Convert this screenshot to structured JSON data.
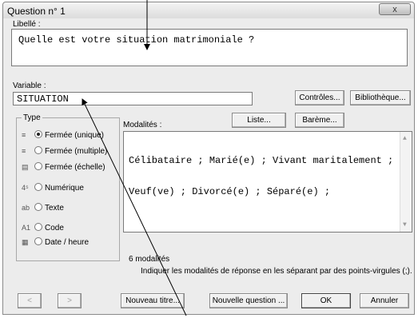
{
  "window": {
    "title": "Question n° 1",
    "close_label": "x"
  },
  "question": {
    "libelle_label": "Libellé :",
    "libelle_value": "Quelle est votre situation matrimoniale ?"
  },
  "variable": {
    "label": "Variable :",
    "value": "SITUATION"
  },
  "buttons": {
    "controles": "Contrôles...",
    "bibliotheque": "Bibliothèque...",
    "liste": "Liste...",
    "bareme": "Barème...",
    "prev": "<",
    "next": ">",
    "nouveau_titre": "Nouveau titre...",
    "nouvelle_question": "Nouvelle question ...",
    "ok": "OK",
    "annuler": "Annuler"
  },
  "type_group": {
    "legend": "Type",
    "options": [
      {
        "icon": "≡",
        "label": "Fermée (unique)",
        "checked": true
      },
      {
        "icon": "≡",
        "label": "Fermée (multiple)",
        "checked": false
      },
      {
        "icon": "▤",
        "label": "Fermée (échelle)",
        "checked": false
      },
      {
        "icon": "4⁵",
        "label": "Numérique",
        "checked": false
      },
      {
        "icon": "ab",
        "label": "Texte",
        "checked": false
      },
      {
        "icon": "A1",
        "label": "Code",
        "checked": false
      },
      {
        "icon": "▦",
        "label": "Date / heure",
        "checked": false
      }
    ]
  },
  "modalites": {
    "label": "Modalités :",
    "line1": "Célibataire ; Marié(e) ; Vivant maritalement ;",
    "line2": "Veuf(ve) ; Divorcé(e) ; Séparé(e) ;",
    "count": "6 modalités",
    "hint": "Indiquer les modalités de réponse en les séparant par des points-virgules (;)."
  }
}
